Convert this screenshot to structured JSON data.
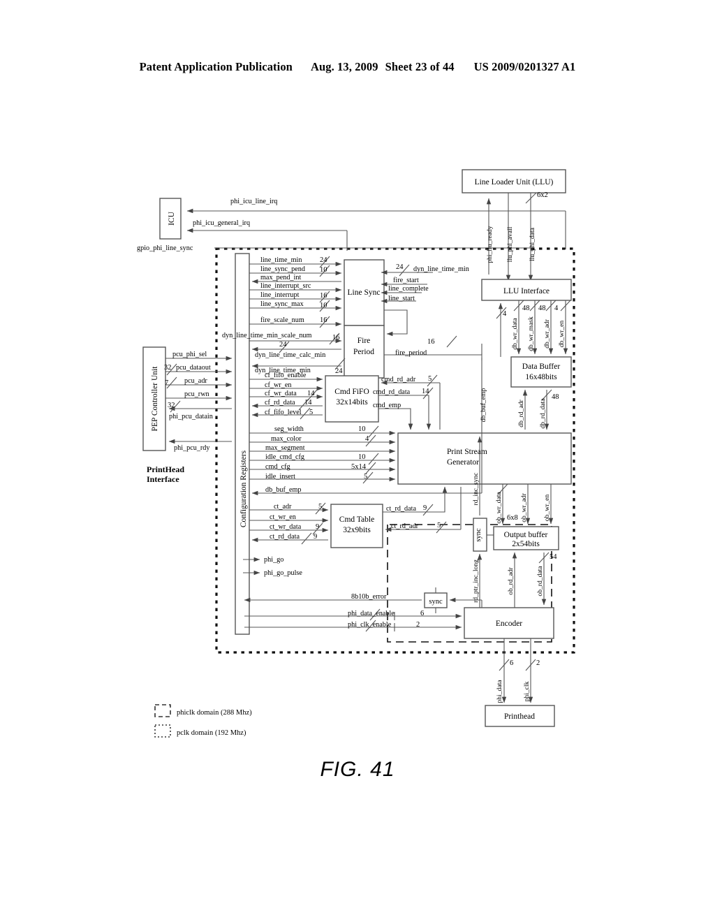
{
  "header": {
    "publication": "Patent Application Publication",
    "date": "Aug. 13, 2009",
    "sheet": "Sheet 23 of 44",
    "patent_number": "US 2009/0201327 A1"
  },
  "figure": {
    "caption": "FIG. 41"
  },
  "blocks": {
    "icu": "ICU",
    "llu": "Line Loader Unit (LLU)",
    "pcu": "PEP Controller Unit",
    "config_registers": "Configuration Registers",
    "printhead_interface": "PrintHead\nInterface",
    "printhead_interface_l1": "PrintHead",
    "printhead_interface_l2": "Interface",
    "line_sync": "Line Sync",
    "fire_period_l1": "Fire",
    "fire_period_l2": "Period",
    "cmd_fifo_l1": "Cmd FiFO",
    "cmd_fifo_l2": "32x14bits",
    "cmd_table_l1": "Cmd Table",
    "cmd_table_l2": "32x9bits",
    "llu_interface": "LLU Interface",
    "data_buffer_l1": "Data Buffer",
    "data_buffer_l2": "16x48bits",
    "print_stream_generator_l1": "Print Stream",
    "print_stream_generator_l2": "Generator",
    "output_buffer_l1": "Output buffer",
    "output_buffer_l2": "2x54bits",
    "encoder": "Encoder",
    "printhead": "Printhead",
    "sync1": "sync",
    "sync2": "sync"
  },
  "signals": {
    "phi_icu_line_irq": "phi_icu_line_irq",
    "phi_icu_general_irq": "phi_icu_general_irq",
    "gpio_phi_line_sync": "gpio_phi_line_sync",
    "phi_llu_ready": "phi_llu_ready",
    "llu_phi_avail": "llu_phi_avail",
    "llu_phi_data": "llu_phi_data",
    "llu_phi_data_width": "6x2",
    "line_time_min": "line_time_min",
    "line_time_min_w": "24",
    "line_sync_pend": "line_sync_pend",
    "line_sync_pend_w": "10",
    "max_pend_int": "max_pend_int",
    "line_interrupt_src": "line_interrupt_src",
    "line_interrupt": "line_interrupt",
    "line_interrupt_w": "16",
    "line_sync_max": "line_sync_max",
    "line_sync_max_w": "10",
    "fire_scale_num": "fire_scale_num",
    "fire_scale_num_w": "16",
    "dyn_line_time_min_scale_num": "dyn_line_time_min_scale_num",
    "dyn_line_time_min_scale_num_w": "16",
    "dyn_line_time_calc_min": "dyn_line_time_calc_min",
    "dyn_line_time_calc_min_w": "24",
    "dyn_line_time_min": "dyn_line_time_min",
    "dyn_line_time_min_w": "24",
    "dyn_line_time_min_out": "dyn_line_time_min",
    "dyn_line_time_min_out_w": "24",
    "fire_start": "fire_start",
    "line_complete": "line_complete",
    "line_start": "line_start",
    "fire_period": "fire_period",
    "fire_period_w": "16",
    "cf_fifo_enable": "cf_fifo_enable",
    "cf_wr_en": "cf_wr_en",
    "cf_wr_data": "cf_wr_data",
    "cf_wr_data_w": "14",
    "cf_rd_data": "cf_rd_data",
    "cf_rd_data_w": "14",
    "cf_fifo_level": "cf_fifo_level",
    "cf_fifo_level_w": "5",
    "cmd_rd_adr": "cmd_rd_adr",
    "cmd_rd_adr_w": "5",
    "cmd_rd_data": "cmd_rd_data",
    "cmd_rd_data_w": "14",
    "cmd_emp": "cmd_emp",
    "seg_width": "seg_width",
    "seg_width_w": "10",
    "max_color": "max_color",
    "max_color_w": "4",
    "max_segment": "max_segment",
    "idle_cmd_cfg": "idle_cmd_cfg",
    "idle_cmd_cfg_w": "10",
    "cmd_cfg": "cmd_cfg",
    "cmd_cfg_w": "5x14",
    "idle_insert": "idle_insert",
    "idle_insert_w": "5",
    "db_buf_emp_left": "db_buf_emp",
    "db_buf_emp_vert": "db_buf_emp",
    "ct_adr": "ct_adr",
    "ct_adr_w": "5",
    "ct_wr_en": "ct_wr_en",
    "ct_wr_data": "ct_wr_data",
    "ct_wr_data_w": "9",
    "ct_rd_data_left": "ct_rd_data",
    "ct_rd_data_left_w": "9",
    "ct_rd_data_right": "ct_rd_data",
    "ct_rd_data_right_w": "9",
    "ct_rd_adr": "ct_rd_adr",
    "ct_rd_adr_w": "5",
    "phi_go": "phi_go",
    "phi_go_pulse": "phi_go_pulse",
    "b8b10b_error": "8b10b_error",
    "phi_data_enable": "phi_data_enable",
    "phi_data_enable_w": "6",
    "phi_clk_enable": "phi_clk_enable",
    "phi_clk_enable_w": "2",
    "pcu_phi_sel": "pcu_phi_sel",
    "pcu_dataout": "pcu_dataout",
    "pcu_dataout_w": "32",
    "pcu_adr": "pcu_adr",
    "pcu_adr_w": "7",
    "pcu_rwn": "pcu_rwn",
    "phi_pcu_datain": "phi_pcu_datain",
    "phi_pcu_datain_w": "32",
    "phi_pcu_rdy": "phi_pcu_rdy",
    "db_wr_data": "db_wr_data",
    "db_wr_data_w": "48",
    "db_wr_mask": "db_wr_mask",
    "db_wr_mask_w": "48",
    "db_wr_adr": "db_wr_adr",
    "db_wr_adr_w": "4",
    "db_wr_en": "db_wr_en",
    "db_wr_en_w": "4",
    "db_rd_adr": "db_rd_adr",
    "db_rd_data": "db_rd_data",
    "db_rd_data_w": "48",
    "ob_wr_data": "ob_wr_data",
    "ob_wr_data_w": "6x8",
    "ob_wr_adr": "ob_wr_adr",
    "ob_wr_en": "ob_wr_en",
    "rd_inc_sync": "rd_inc_sync",
    "rd_ptr_inc_long": "rd_ptr_inc_long",
    "ob_rd_adr": "ob_rd_adr",
    "ob_rd_data": "ob_rd_data",
    "ob_rd_data_w": "54",
    "ob_rd_data_w2": "54",
    "phi_data": "phi_data",
    "phi_data_w": "6",
    "phi_clk": "phi_clk",
    "phi_clk_w": "2"
  },
  "legend": {
    "phiclk": "phiclk domain (288 Mhz)",
    "pclk": "pclk domain (192 Mhz)"
  },
  "colors": {
    "stroke": "#555555",
    "text": "#000000",
    "background": "#ffffff"
  }
}
